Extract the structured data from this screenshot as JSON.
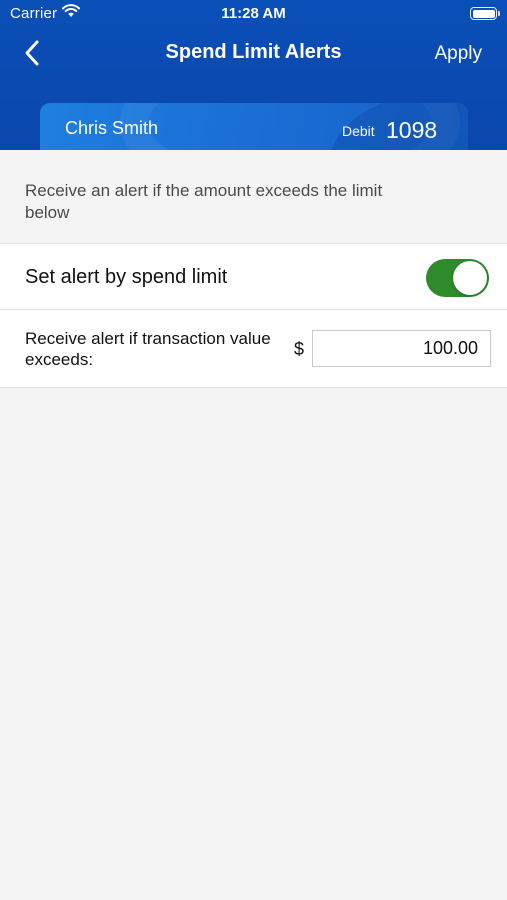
{
  "status_bar": {
    "carrier": "Carrier",
    "time": "11:28 AM"
  },
  "nav": {
    "title": "Spend Limit Alerts",
    "apply_label": "Apply"
  },
  "card": {
    "holder_name": "Chris Smith",
    "type": "Debit",
    "last_digits": "1098"
  },
  "intro_text": "Receive an alert if the amount exceeds the limit below",
  "toggle_row": {
    "label": "Set alert by spend limit",
    "enabled": true
  },
  "amount_row": {
    "label": "Receive alert if transaction value exceeds:",
    "currency_symbol": "$",
    "value": "100.00"
  },
  "colors": {
    "header_blue": "#0a4fb8",
    "toggle_on": "#2e8b2b"
  }
}
